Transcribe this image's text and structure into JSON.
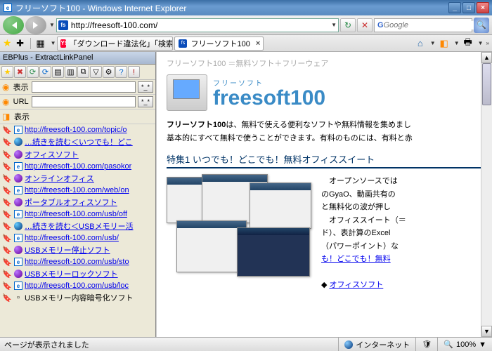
{
  "window": {
    "title": "フリーソフト100 - Windows Internet Explorer"
  },
  "address": {
    "url": "http://freesoft-100.com/"
  },
  "search": {
    "placeholder": "Google"
  },
  "tabs": [
    {
      "label": "「ダウンロード違法化」「検索…"
    },
    {
      "label": "フリーソフト100"
    }
  ],
  "panel": {
    "title": "EBPlus - ExtractLinkPanel",
    "row_display": "表示",
    "row_url": "URL",
    "row_display2": "表示",
    "items": [
      {
        "icon": "bk",
        "type": "blue",
        "text": "…続きを読む＜いつでも！どこ"
      },
      {
        "icon": "bk",
        "type": "purple",
        "text": "オフィスソフト"
      },
      {
        "icon": "bk",
        "type": "e",
        "text": "http://freesoft-100.com/pasokor"
      },
      {
        "icon": "bk",
        "type": "purple",
        "text": "オンラインオフィス"
      },
      {
        "icon": "bk",
        "type": "e",
        "text": "http://freesoft-100.com/web/on"
      },
      {
        "icon": "bk",
        "type": "purple",
        "text": "ポータブルオフィスソフト"
      },
      {
        "icon": "bk",
        "type": "e",
        "text": "http://freesoft-100.com/usb/off"
      },
      {
        "icon": "bk",
        "type": "blue",
        "text": "…続きを読む＜USBメモリー活"
      },
      {
        "icon": "bk",
        "type": "e",
        "text": "http://freesoft-100.com/usb/"
      },
      {
        "icon": "bk",
        "type": "purple",
        "text": "USBメモリー停止ソフト"
      },
      {
        "icon": "bk",
        "type": "e",
        "text": "http://freesoft-100.com/usb/sto"
      },
      {
        "icon": "bk",
        "type": "purple",
        "text": "USBメモリーロックソフト"
      },
      {
        "icon": "bk",
        "type": "e",
        "text": "http://freesoft-100.com/usb/loc"
      },
      {
        "icon": "bk",
        "type": "black",
        "text": "USBメモリー内容暗号化ソフト"
      }
    ],
    "topic_url": "http://freesoft-100.com/topic/o"
  },
  "page": {
    "breadcrumb": "フリーソフト100 ＝無料ソフト＋フリーウェア",
    "logo_sub": "フリーソフト",
    "logo_main": "freesoft100",
    "intro1a": "フリーソフト100",
    "intro1b": "は、無料で使える便利なソフトや無料情報を集めまし",
    "intro2": "基本的にすべて無料で使うことができます。有料のものには、有料と赤",
    "section_title": "特集1 いつでも！どこでも！無料オフィススイート",
    "side1": "　オープンソースでは",
    "side2": "のGyaO、動画共有の",
    "side3": "と無料化の波が押し",
    "side4": "　オフィススイート（＝",
    "side5": "ド）、表計算のExcel",
    "side6": "（パワーポイント）な",
    "side7": "も！どこでも！無料",
    "link1": "オフィスソフト"
  },
  "status": {
    "text": "ページが表示されました",
    "zone": "インターネット",
    "zoom": "100%"
  }
}
